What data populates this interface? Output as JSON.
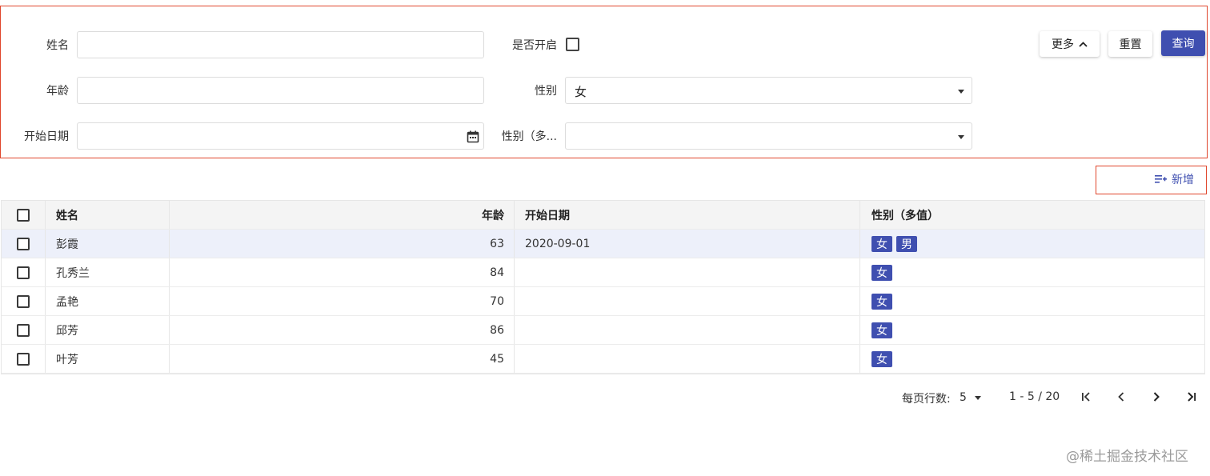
{
  "filters": {
    "name_label": "姓名",
    "name_value": "",
    "age_label": "年龄",
    "age_value": "",
    "start_date_label": "开始日期",
    "start_date_value": "",
    "enabled_label": "是否开启",
    "gender_label": "性别",
    "gender_value": "女",
    "gender_multi_label": "性别（多...",
    "gender_multi_value": ""
  },
  "buttons": {
    "more": "更多",
    "reset": "重置",
    "query": "查询",
    "add": "新增"
  },
  "table": {
    "columns": [
      "姓名",
      "年龄",
      "开始日期",
      "性别（多值）"
    ],
    "rows": [
      {
        "name": "彭霞",
        "age": "63",
        "start_date": "2020-09-01",
        "genders": [
          "女",
          "男"
        ]
      },
      {
        "name": "孔秀兰",
        "age": "84",
        "start_date": "",
        "genders": [
          "女"
        ]
      },
      {
        "name": "孟艳",
        "age": "70",
        "start_date": "",
        "genders": [
          "女"
        ]
      },
      {
        "name": "邱芳",
        "age": "86",
        "start_date": "",
        "genders": [
          "女"
        ]
      },
      {
        "name": "叶芳",
        "age": "45",
        "start_date": "",
        "genders": [
          "女"
        ]
      }
    ]
  },
  "pagination": {
    "rows_per_page_label": "每页行数:",
    "rows_per_page_value": "5",
    "range_text": "1 - 5 / 20"
  },
  "watermark": "@稀土掘金技术社区",
  "colors": {
    "primary": "#3f4fb0",
    "highlight_border": "#e0462c",
    "selected_row": "#edf0fa"
  }
}
